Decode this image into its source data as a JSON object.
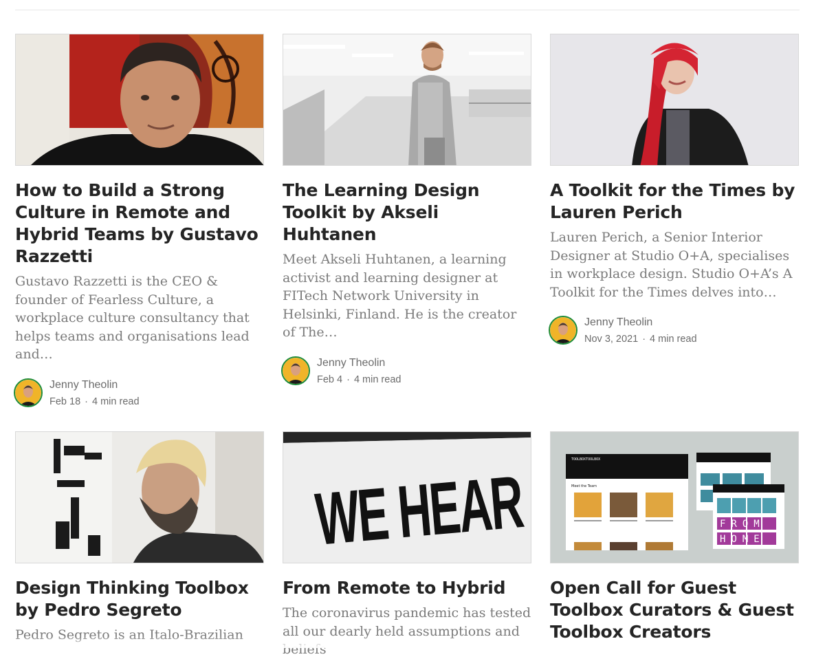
{
  "articles": [
    {
      "title": "How to Build a Strong Culture in Remote and Hybrid Teams by Gustavo Razzetti",
      "excerpt": "Gustavo Razzetti is the CEO & founder of Fearless Culture, a workplace culture consultancy that helps teams and organisations lead and…",
      "author": "Jenny Theolin",
      "date": "Feb 18",
      "read_time": "4 min read"
    },
    {
      "title": "The Learning Design Toolkit by Akseli Huhtanen",
      "excerpt": "Meet Akseli Huhtanen, a learning activist and learning designer at FITech Network University in Helsinki, Finland. He is the creator of The…",
      "author": "Jenny Theolin",
      "date": "Feb 4",
      "read_time": "4 min read"
    },
    {
      "title": "A Toolkit for the Times by Lauren Perich",
      "excerpt": "Lauren Perich, a Senior Interior Designer at Studio O+A, specialises in workplace design. Studio O+A’s A Toolkit for the Times delves into…",
      "author": "Jenny Theolin",
      "date": "Nov 3, 2021",
      "read_time": "4 min read"
    },
    {
      "title": "Design Thinking Toolbox by Pedro Segreto",
      "excerpt": "Pedro Segreto is an Italo-Brazilian"
    },
    {
      "title": "From Remote to Hybrid",
      "excerpt": "The coronavirus pandemic has tested all our dearly held assumptions and beliefs"
    },
    {
      "title": "Open Call for Guest Toolbox Curators & Guest Toolbox Creators",
      "excerpt": ""
    }
  ],
  "image_text": {
    "sign": "WE HEAR YOU.",
    "mock_brand": "TOOLBOXTOOLBOX",
    "mock_heading": "Meet the Team",
    "mock_tiles_1": "FROM",
    "mock_tiles_2": "HOME"
  },
  "colors": {
    "title": "#242424",
    "excerpt": "#7a7a7a",
    "meta": "#6b6b6b",
    "avatar_ring": "#1e8c3a"
  },
  "separator": "·"
}
